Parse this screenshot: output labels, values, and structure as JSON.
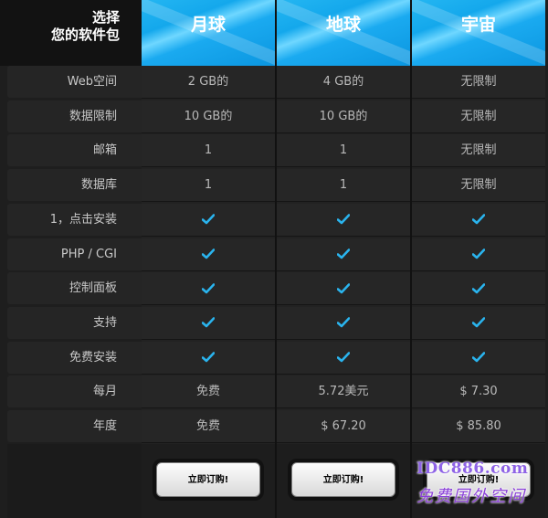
{
  "header": {
    "corner_line1": "选择",
    "corner_line2": "您的软件包",
    "plans": [
      "月球",
      "地球",
      "宇宙"
    ]
  },
  "features": [
    {
      "label": "Web空间",
      "values": [
        "2 GB的",
        "4 GB的",
        "无限制"
      ]
    },
    {
      "label": "数据限制",
      "values": [
        "10 GB的",
        "10 GB的",
        "无限制"
      ]
    },
    {
      "label": "邮箱",
      "values": [
        "1",
        "1",
        "无限制"
      ]
    },
    {
      "label": "数据库",
      "values": [
        "1",
        "1",
        "无限制"
      ]
    },
    {
      "label": "1，点击安装",
      "values": [
        "check",
        "check",
        "check"
      ]
    },
    {
      "label": "PHP / CGI",
      "values": [
        "check",
        "check",
        "check"
      ]
    },
    {
      "label": "控制面板",
      "values": [
        "check",
        "check",
        "check"
      ]
    },
    {
      "label": "支持",
      "values": [
        "check",
        "check",
        "check"
      ]
    },
    {
      "label": "免费安装",
      "values": [
        "check",
        "check",
        "check"
      ]
    },
    {
      "label": "每月",
      "values": [
        "免费",
        "5.72美元",
        "$ 7.30"
      ]
    },
    {
      "label": "年度",
      "values": [
        "免费",
        "$ 67.20",
        "$ 85.80"
      ]
    }
  ],
  "order_label": "立即订购!",
  "watermark": {
    "url": "IDC886.com",
    "name": "免费国外空间"
  },
  "colors": {
    "accent": "#1aaaf0",
    "check": "#2ab4ee",
    "background": "#1e1e1e"
  },
  "icons": {
    "check": "checkmark-icon"
  }
}
